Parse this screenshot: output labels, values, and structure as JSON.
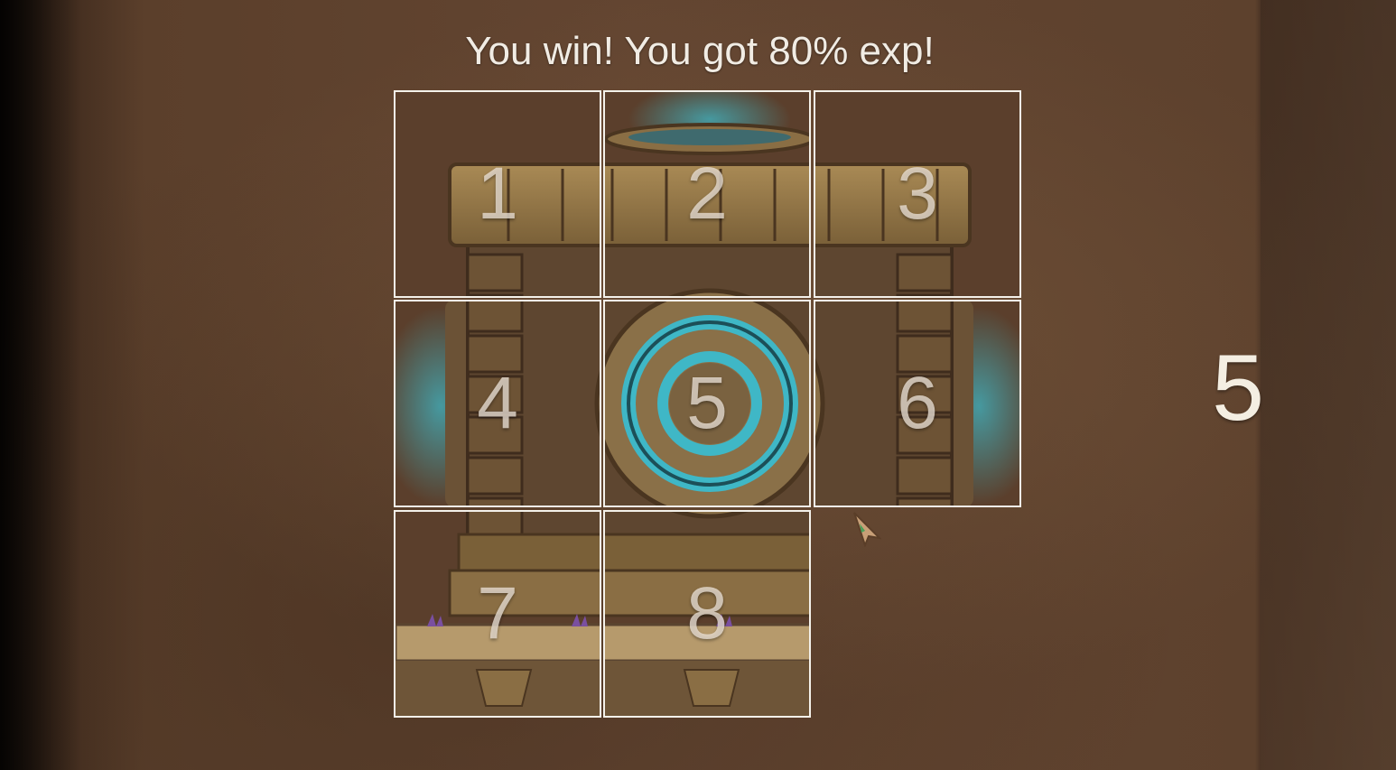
{
  "message": "You win! You got 80% exp!",
  "tiles": [
    "1",
    "2",
    "3",
    "4",
    "5",
    "6",
    "7",
    "8"
  ],
  "move_count": "5",
  "colors": {
    "tile_border": "#f4f1ea",
    "stone": "#a4844f",
    "glow": "#3fb7c6",
    "background": "#5d412d"
  },
  "icons": {
    "cursor": "arrow-cursor-icon"
  }
}
